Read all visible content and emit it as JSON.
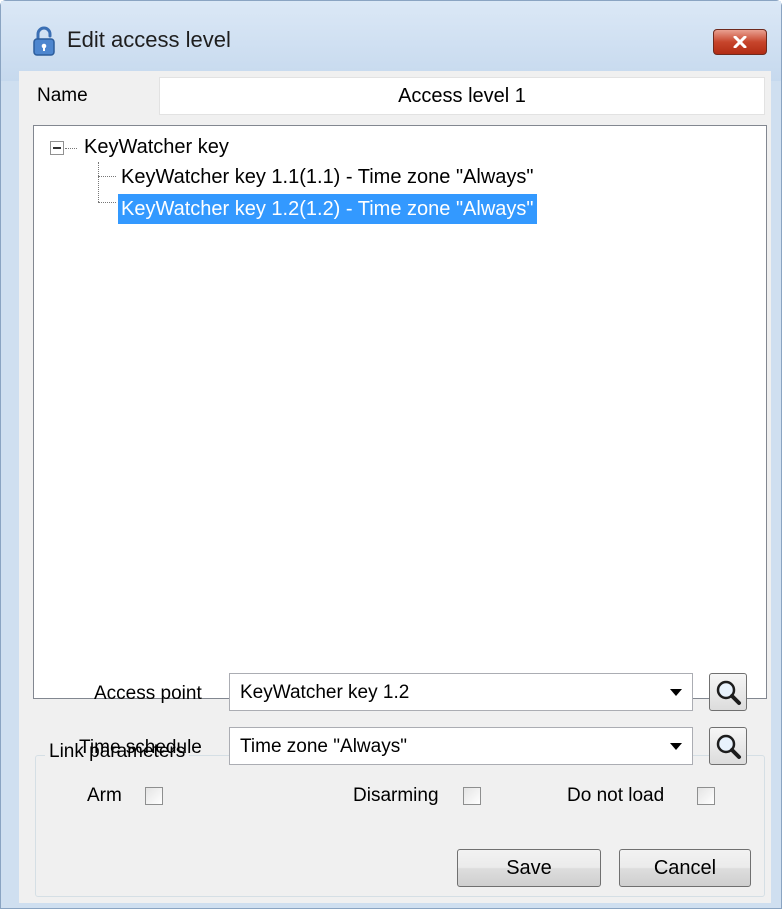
{
  "window": {
    "title": "Edit access level",
    "title_icon": "lock-icon",
    "close_icon": "close-icon"
  },
  "name_field": {
    "label": "Name",
    "value": "Access level 1"
  },
  "tree": {
    "root": {
      "label": "KeyWatcher key",
      "expanded": true,
      "toggle_icon": "minus-box-icon"
    },
    "children": [
      {
        "label": "KeyWatcher key 1.1(1.1) - Time zone \"Always\"",
        "selected": false
      },
      {
        "label": "KeyWatcher key 1.2(1.2) - Time zone \"Always\"",
        "selected": true
      }
    ],
    "selection_color": "#3399ff"
  },
  "link_parameters": {
    "legend": "Link parameters",
    "access_point": {
      "label": "Access point",
      "value": "KeyWatcher key 1.2",
      "search_icon": "magnifier-icon"
    },
    "time_schedule": {
      "label": "Time schedule",
      "value": "Time zone \"Always\"",
      "search_icon": "magnifier-icon"
    },
    "checkboxes": [
      {
        "label": "Arm",
        "checked": false
      },
      {
        "label": "Disarming",
        "checked": false
      },
      {
        "label": "Do not load",
        "checked": false
      }
    ]
  },
  "buttons": {
    "save": "Save",
    "cancel": "Cancel"
  },
  "colors": {
    "close_button": "#c7452c",
    "frame": "#cfdff0",
    "selection": "#3399ff"
  }
}
